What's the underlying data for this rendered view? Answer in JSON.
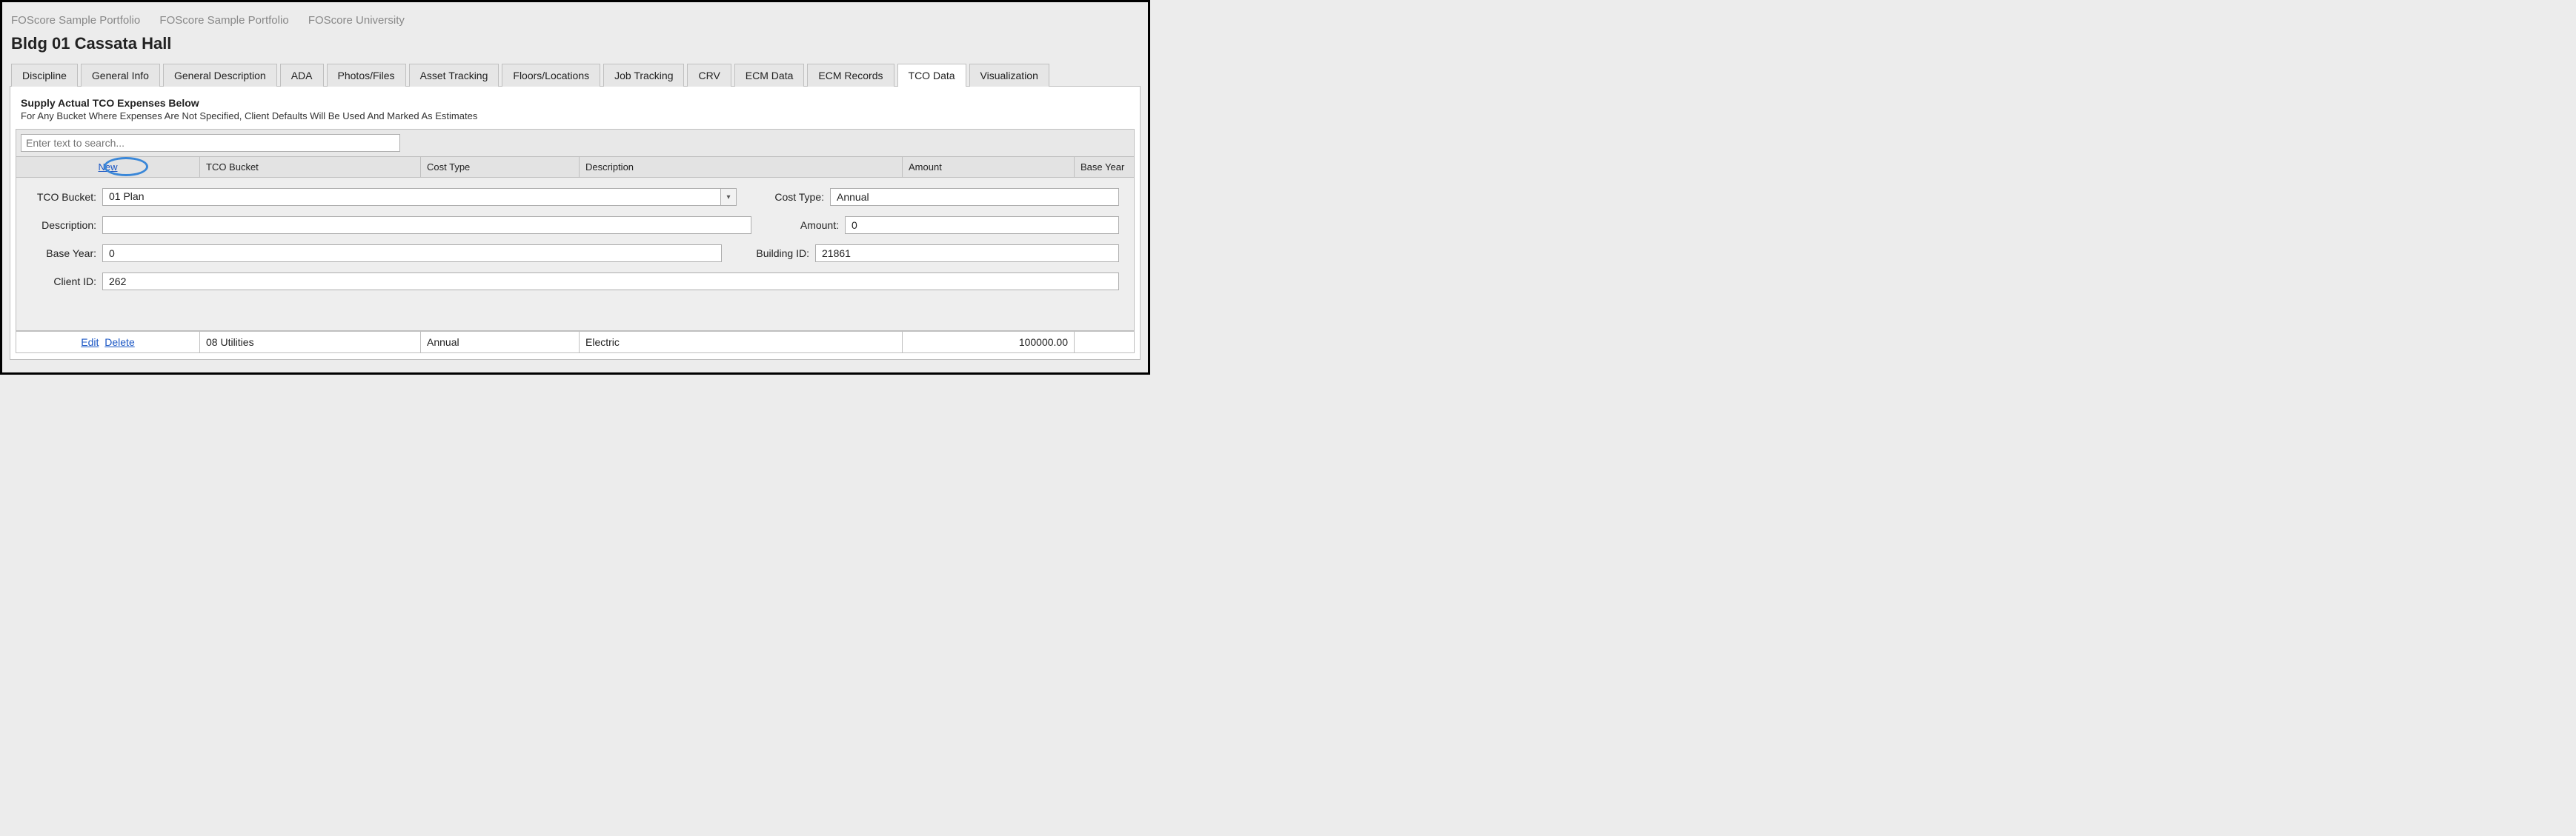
{
  "breadcrumbs": [
    "FOScore Sample Portfolio",
    "FOScore Sample Portfolio",
    "FOScore University"
  ],
  "page_title": "Bldg 01 Cassata Hall",
  "tabs": [
    "Discipline",
    "General Info",
    "General Description",
    "ADA",
    "Photos/Files",
    "Asset Tracking",
    "Floors/Locations",
    "Job Tracking",
    "CRV",
    "ECM Data",
    "ECM Records",
    "TCO Data",
    "Visualization"
  ],
  "active_tab": "TCO Data",
  "section": {
    "title": "Supply Actual TCO Expenses Below",
    "sub": "For Any Bucket Where Expenses Are Not Specified, Client Defaults Will Be Used And Marked As Estimates"
  },
  "search": {
    "placeholder": "Enter text to search...",
    "value": ""
  },
  "grid": {
    "new_label": "New",
    "headers": [
      "TCO Bucket",
      "Cost Type",
      "Description",
      "Amount",
      "Base Year"
    ],
    "edit_label": "Edit",
    "delete_label": "Delete"
  },
  "form": {
    "labels": {
      "tco_bucket": "TCO Bucket:",
      "cost_type": "Cost Type:",
      "description": "Description:",
      "amount": "Amount:",
      "base_year": "Base Year:",
      "building_id": "Building ID:",
      "client_id": "Client ID:"
    },
    "values": {
      "tco_bucket": "01 Plan",
      "cost_type": "Annual",
      "description": "",
      "amount": "0",
      "base_year": "0",
      "building_id": "21861",
      "client_id": "262"
    }
  },
  "rows": [
    {
      "bucket": "08 Utilities",
      "cost_type": "Annual",
      "desc": "Electric",
      "amount": "100000.00",
      "base_year": ""
    }
  ]
}
